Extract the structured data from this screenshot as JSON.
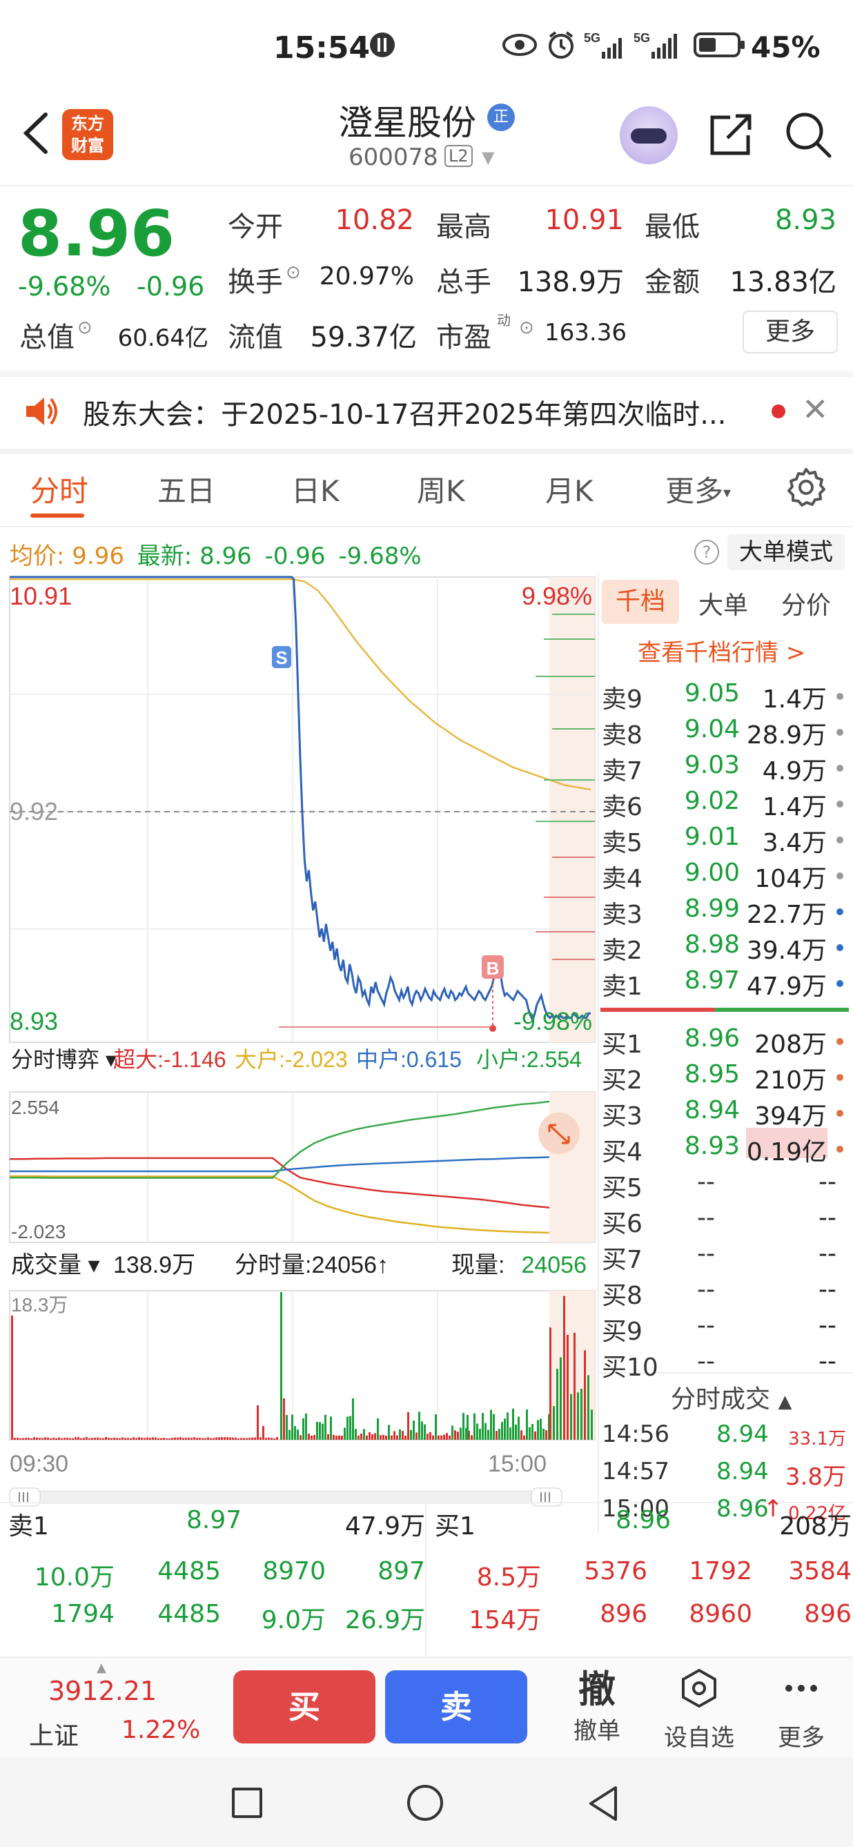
{
  "status": {
    "time": "15:54",
    "battery": "45%",
    "net1": "5G",
    "net2": "5G"
  },
  "header": {
    "logo_line1": "东方",
    "logo_line2": "财富",
    "stock_name": "澄星股份",
    "badge": "正",
    "code": "600078",
    "level": "L2"
  },
  "quote": {
    "price": "8.96",
    "pct": "-9.68%",
    "chg": "-0.96",
    "rows": [
      [
        {
          "label": "今开",
          "value": "10.82",
          "color": "red"
        },
        {
          "label": "最高",
          "value": "10.91",
          "color": "red"
        },
        {
          "label": "最低",
          "value": "8.93",
          "color": "green"
        }
      ],
      [
        {
          "label": "换手",
          "value": "20.97%",
          "color": "black"
        },
        {
          "label": "总手",
          "value": "138.9万",
          "color": "black"
        },
        {
          "label": "金额",
          "value": "13.83亿",
          "color": "black"
        }
      ],
      [
        {
          "label": "总值",
          "value": "60.64亿",
          "color": "black"
        },
        {
          "label": "流值",
          "value": "59.37亿",
          "color": "black"
        },
        {
          "label": "市盈",
          "sup": "动",
          "value": "163.36",
          "color": "black"
        }
      ]
    ],
    "more": "更多"
  },
  "notice": {
    "text": "股东大会：于2025-10-17召开2025年第四次临时..."
  },
  "tabs": [
    "分时",
    "五日",
    "日K",
    "周K",
    "月K",
    "更多"
  ],
  "avg": {
    "avg_label": "均价:",
    "avg_value": "9.96",
    "latest_label": "最新:",
    "latest_value": "8.96",
    "chg": "-0.96",
    "pct": "-9.68%"
  },
  "big_order_mode": "大单模式",
  "chart": {
    "price_high": "10.91",
    "pct_high": "9.98%",
    "price_mid": "9.92",
    "price_low": "8.93",
    "pct_low": "-9.98%",
    "marker_s": "S",
    "marker_b": "B",
    "flow_selector": "分时博弈",
    "flow_legend": [
      {
        "label": "超大:",
        "value": "-1.146",
        "color": "#d9302e"
      },
      {
        "label": "大户:",
        "value": "-2.023",
        "color": "#e0b020"
      },
      {
        "label": "中户:",
        "value": "0.615",
        "color": "#2e6fc4"
      },
      {
        "label": "小户:",
        "value": "2.554",
        "color": "#1a9e3a"
      }
    ],
    "flow_max": "2.554",
    "flow_min": "-2.023",
    "vol_selector": "成交量",
    "vol_total": "138.9万",
    "vol_min_label": "分时量:",
    "vol_min_value": "24056",
    "vol_now_label": "现量:",
    "vol_now_value": "24056",
    "vol_max": "18.3万",
    "time_start": "09:30",
    "time_end": "15:00"
  },
  "orderbook": {
    "tabs": [
      "千档",
      "大单",
      "分价"
    ],
    "link": "查看千档行情 >",
    "asks": [
      {
        "label": "卖9",
        "price": "9.05",
        "vol": "1.4万",
        "dot": "#999"
      },
      {
        "label": "卖8",
        "price": "9.04",
        "vol": "28.9万",
        "dot": "#999"
      },
      {
        "label": "卖7",
        "price": "9.03",
        "vol": "4.9万",
        "dot": "#999"
      },
      {
        "label": "卖6",
        "price": "9.02",
        "vol": "1.4万",
        "dot": "#999"
      },
      {
        "label": "卖5",
        "price": "9.01",
        "vol": "3.4万",
        "dot": "#999"
      },
      {
        "label": "卖4",
        "price": "9.00",
        "vol": "104万",
        "dot": "#999"
      },
      {
        "label": "卖3",
        "price": "8.99",
        "vol": "22.7万",
        "dot": "#2e6fc4"
      },
      {
        "label": "卖2",
        "price": "8.98",
        "vol": "39.4万",
        "dot": "#2e6fc4"
      },
      {
        "label": "卖1",
        "price": "8.97",
        "vol": "47.9万",
        "dot": "#2e6fc4"
      }
    ],
    "bids": [
      {
        "label": "买1",
        "price": "8.96",
        "vol": "208万",
        "dot": "#e07040"
      },
      {
        "label": "买2",
        "price": "8.95",
        "vol": "210万",
        "dot": "#e07040"
      },
      {
        "label": "买3",
        "price": "8.94",
        "vol": "394万",
        "dot": "#e07040"
      },
      {
        "label": "买4",
        "price": "8.93",
        "vol": "0.19亿",
        "dot": "#e07040",
        "highlight": true
      },
      {
        "label": "买5",
        "price": "--",
        "vol": "--"
      },
      {
        "label": "买6",
        "price": "--",
        "vol": "--"
      },
      {
        "label": "买7",
        "price": "--",
        "vol": "--"
      },
      {
        "label": "买8",
        "price": "--",
        "vol": "--"
      },
      {
        "label": "买9",
        "price": "--",
        "vol": "--"
      },
      {
        "label": "买10",
        "price": "--",
        "vol": "--"
      }
    ]
  },
  "ticks": {
    "title": "分时成交",
    "rows": [
      {
        "time": "14:56",
        "price": "8.94",
        "vol": "33.1万",
        "arrow": ""
      },
      {
        "time": "14:57",
        "price": "8.94",
        "vol": "3.8万",
        "arrow": ""
      },
      {
        "time": "15:00",
        "price": "8.96",
        "vol": "0.22亿",
        "arrow": "↑"
      }
    ]
  },
  "bottom_tables": {
    "left": {
      "head_label": "卖1",
      "head_price": "8.97",
      "head_vol": "47.9万",
      "rows": [
        [
          "10.0万",
          "4485",
          "8970",
          "897"
        ],
        [
          "1794",
          "4485",
          "9.0万",
          "26.9万"
        ]
      ]
    },
    "right": {
      "head_label": "买1",
      "head_price": "8.96",
      "head_vol": "208万",
      "rows": [
        [
          "8.5万",
          "5376",
          "1792",
          "3584"
        ],
        [
          "154万",
          "896",
          "8960",
          "896"
        ]
      ]
    }
  },
  "bottombar": {
    "index_value": "3912.21",
    "index_name": "上证",
    "index_pct": "1.22%",
    "buy": "买",
    "sell": "卖",
    "cancel_icon": "撤",
    "cancel": "撤单",
    "watch": "设自选",
    "more": "更多"
  },
  "price_series": [
    10.91,
    10.91,
    10.91,
    10.91,
    10.91,
    10.91,
    10.91,
    10.91,
    10.91,
    10.91,
    10.91,
    10.91,
    10.91,
    10.91,
    10.91,
    10.91,
    10.91,
    10.91,
    10.91,
    10.91,
    10.91,
    10.91,
    10.91,
    10.91,
    10.91,
    10.91,
    10.91,
    10.91,
    10.91,
    10.91,
    10.91,
    10.91,
    10.91,
    10.91,
    10.91,
    10.91,
    10.91,
    10.91,
    10.91,
    10.91,
    10.91,
    10.91,
    10.91,
    10.91,
    10.91,
    10.91,
    10.91,
    10.91,
    10.91,
    10.91,
    10.91,
    10.91,
    10.91,
    10.91,
    10.91,
    10.91,
    10.91,
    10.91,
    10.91,
    10.91,
    10.91,
    10.91,
    10.91,
    10.91,
    10.91,
    10.91,
    10.91,
    10.91,
    10.91,
    10.91,
    10.91,
    10.91,
    10.91,
    10.91,
    10.91,
    10.91,
    10.91,
    10.91,
    10.91,
    10.91,
    10.91,
    10.91,
    10.91,
    10.91,
    10.91,
    10.91,
    10.91,
    10.91,
    10.91,
    10.91,
    10.91,
    10.91,
    10.91,
    10.91,
    10.91,
    10.91,
    10.91,
    10.91,
    10.91,
    10.91,
    10.91,
    10.91,
    10.91,
    10.91,
    10.91,
    10.91,
    10.91,
    10.91,
    10.91,
    10.91,
    10.91,
    10.91,
    10.91,
    10.91,
    10.91,
    10.91,
    10.91,
    10.91,
    10.91,
    10.91,
    10.91,
    10.91,
    10.91,
    10.91,
    10.91,
    10.91,
    10.91,
    10.91,
    10.91,
    10.91,
    10.91,
    10.91,
    10.9,
    10.7,
    10.4,
    10.1,
    9.85,
    9.65,
    9.55,
    9.6,
    9.5,
    9.42,
    9.46,
    9.38,
    9.3,
    9.34,
    9.28,
    9.36,
    9.3,
    9.24,
    9.28,
    9.2,
    9.25,
    9.18,
    9.15,
    9.2,
    9.12,
    9.1,
    9.18,
    9.14,
    9.08,
    9.05,
    9.12,
    9.1,
    9.04,
    9.06,
    9.02,
    9.0,
    9.08,
    9.05,
    9.1,
    9.06,
    9.04,
    9.02,
    9.0,
    9.05,
    9.08,
    9.12,
    9.1,
    9.06,
    9.04,
    9.02,
    9.06,
    9.03,
    9.05,
    9.08,
    9.02,
    9.0,
    9.04,
    9.06,
    9.05,
    9.02,
    9.04,
    9.07,
    9.05,
    9.03,
    9.02,
    9.06,
    9.04,
    9.03,
    9.02,
    9.05,
    9.07,
    9.04,
    9.03,
    9.06,
    9.05,
    9.02,
    9.03,
    9.05,
    9.04,
    9.06,
    9.08,
    9.05,
    9.04,
    9.03,
    9.02,
    9.04,
    9.06,
    9.05,
    9.03,
    9.02,
    9.04,
    9.06,
    9.08,
    9.12,
    9.18,
    9.2,
    9.14,
    9.08,
    9.04,
    9.05,
    9.04,
    9.03,
    9.02,
    9.04,
    9.06,
    9.05,
    9.04,
    9.03,
    9.02,
    8.98,
    8.95,
    8.93,
    8.96,
    9.0,
    9.02,
    9.04,
    9.0,
    8.97,
    8.95,
    8.94,
    8.95,
    8.94,
    8.95,
    8.94,
    8.95,
    8.94,
    8.94,
    8.95,
    8.94,
    8.94,
    8.96,
    8.95,
    8.94,
    8.94,
    8.95,
    8.94,
    8.94,
    8.96,
    8.96
  ],
  "avg_series": [
    10.9,
    10.9,
    10.89,
    10.85,
    10.78,
    10.7,
    10.62,
    10.55,
    10.48,
    10.42,
    10.36,
    10.31,
    10.26,
    10.22,
    10.18,
    10.15,
    10.12,
    10.09,
    10.06,
    10.04,
    10.02,
    10.0,
    9.98,
    9.97,
    9.96
  ],
  "flow_series": {
    "chaoda": [
      0.55,
      0.55,
      0.56,
      0.56,
      0.57,
      0.57,
      0.57,
      0.58,
      0.58,
      0.58,
      0.58,
      0.58,
      0.58,
      0.58,
      0.58,
      0.58,
      0.58,
      0.58,
      0.58,
      0.58,
      0.2,
      -0.1,
      -0.2,
      -0.3,
      -0.38,
      -0.45,
      -0.52,
      -0.58,
      -0.62,
      -0.66,
      -0.7,
      -0.74,
      -0.78,
      -0.82,
      -0.86,
      -0.92,
      -0.98,
      -1.05,
      -1.1,
      -1.146
    ],
    "dahu": [
      -0.05,
      -0.05,
      -0.05,
      -0.06,
      -0.06,
      -0.06,
      -0.06,
      -0.06,
      -0.06,
      -0.06,
      -0.06,
      -0.06,
      -0.06,
      -0.06,
      -0.06,
      -0.06,
      -0.06,
      -0.06,
      -0.06,
      -0.06,
      -0.3,
      -0.6,
      -0.9,
      -1.1,
      -1.25,
      -1.38,
      -1.48,
      -1.56,
      -1.64,
      -1.7,
      -1.76,
      -1.82,
      -1.86,
      -1.9,
      -1.93,
      -1.96,
      -1.98,
      -2.0,
      -2.01,
      -2.023
    ],
    "zhonghu": [
      0.12,
      0.12,
      0.12,
      0.12,
      0.12,
      0.12,
      0.12,
      0.12,
      0.12,
      0.12,
      0.12,
      0.12,
      0.12,
      0.12,
      0.12,
      0.12,
      0.12,
      0.12,
      0.12,
      0.12,
      0.18,
      0.22,
      0.26,
      0.3,
      0.33,
      0.36,
      0.38,
      0.4,
      0.42,
      0.44,
      0.46,
      0.48,
      0.5,
      0.52,
      0.54,
      0.55,
      0.57,
      0.59,
      0.6,
      0.615
    ],
    "xiaohu": [
      -0.1,
      -0.1,
      -0.1,
      -0.11,
      -0.11,
      -0.11,
      -0.11,
      -0.11,
      -0.11,
      -0.11,
      -0.11,
      -0.11,
      -0.11,
      -0.11,
      -0.11,
      -0.11,
      -0.11,
      -0.11,
      -0.11,
      -0.11,
      0.4,
      0.8,
      1.1,
      1.3,
      1.45,
      1.58,
      1.68,
      1.76,
      1.84,
      1.92,
      1.98,
      2.04,
      2.1,
      2.18,
      2.26,
      2.34,
      2.4,
      2.46,
      2.5,
      2.554
    ]
  },
  "colors": {
    "up": "#d9302e",
    "down": "#1a9e3a",
    "accent": "#e8541e",
    "price_line": "#2e62b8",
    "avg_line": "#e8b842"
  }
}
